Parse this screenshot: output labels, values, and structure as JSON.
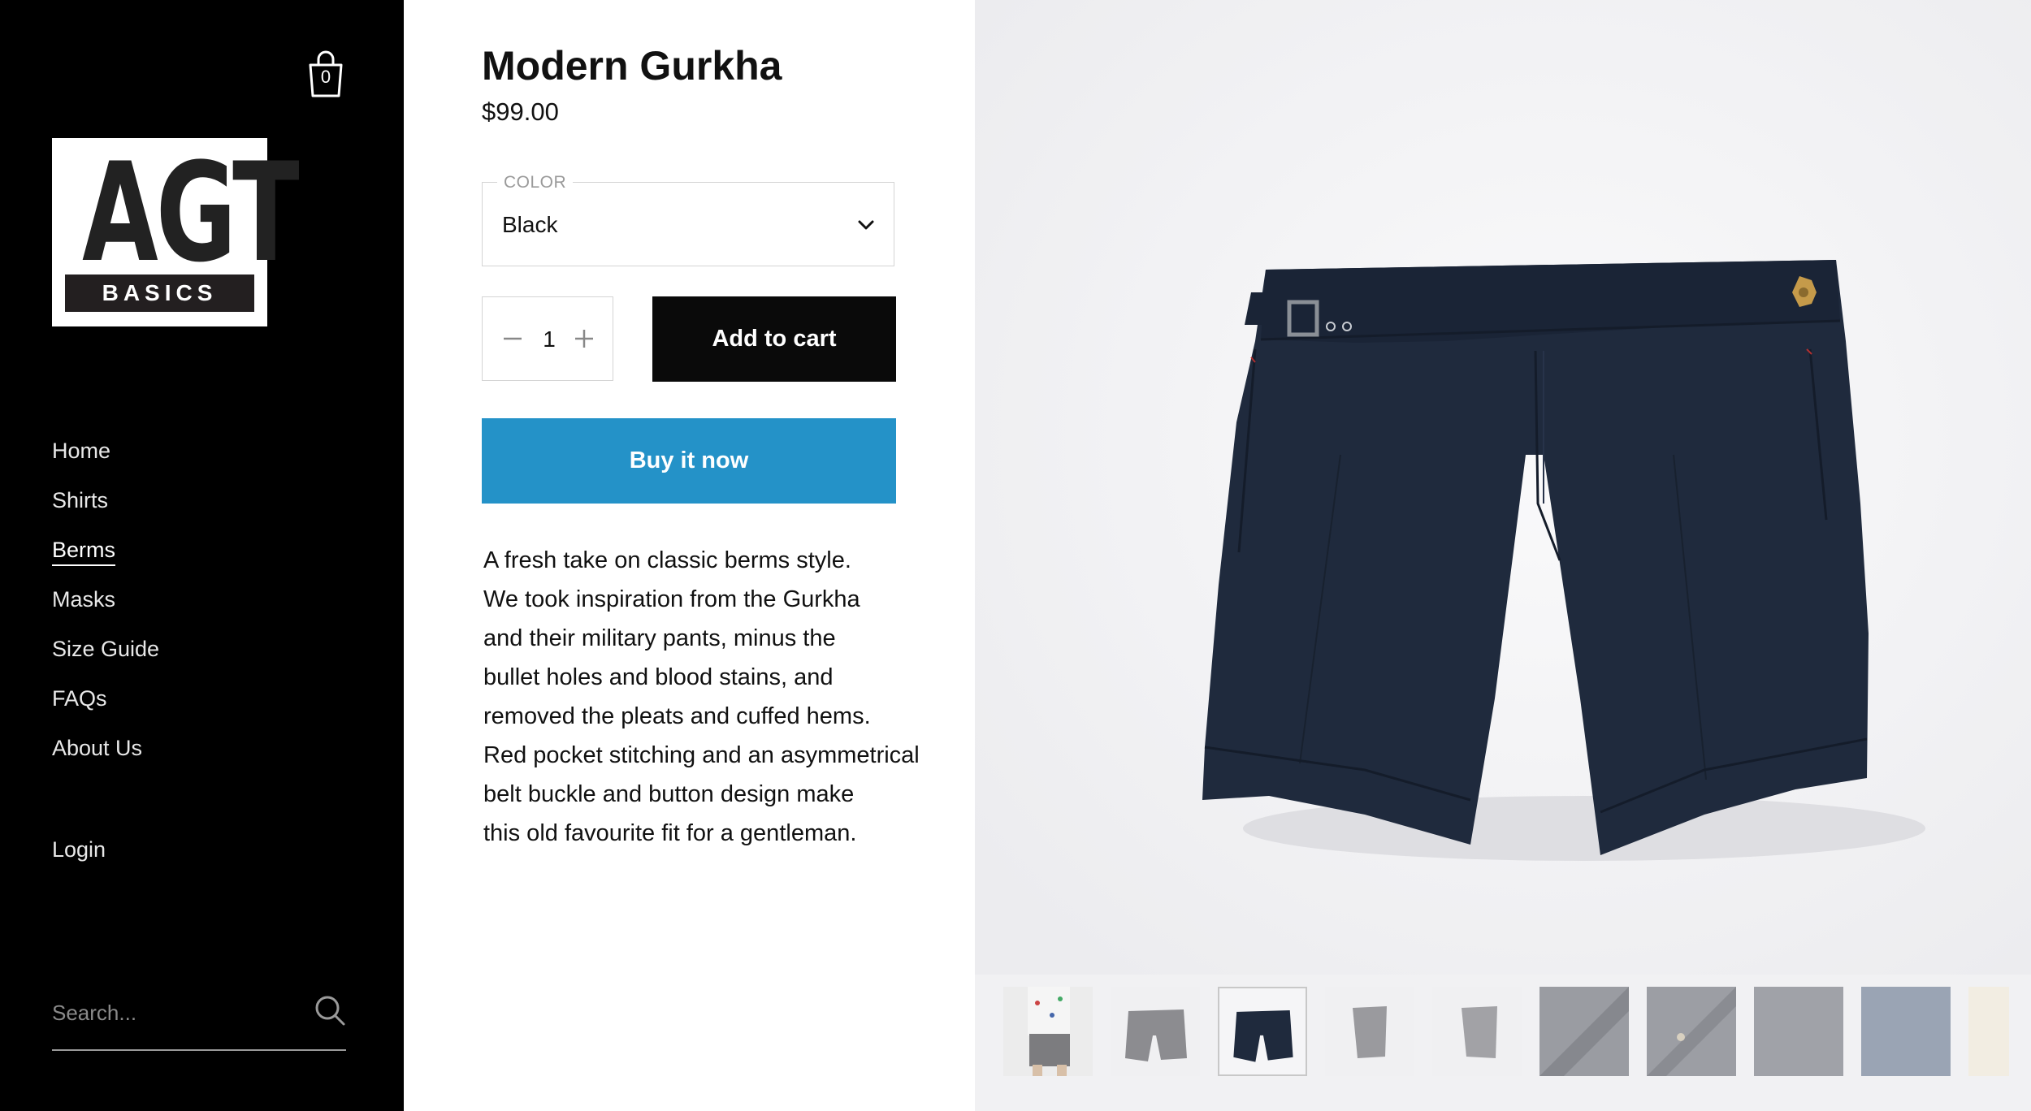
{
  "cart": {
    "count": "0"
  },
  "logo": {
    "big": "AGT",
    "band": "BASICS"
  },
  "nav": {
    "items": [
      {
        "label": "Home"
      },
      {
        "label": "Shirts"
      },
      {
        "label": "Berms",
        "active": true
      },
      {
        "label": "Masks"
      },
      {
        "label": "Size Guide"
      },
      {
        "label": "FAQs"
      },
      {
        "label": "About Us"
      }
    ],
    "login": "Login"
  },
  "search": {
    "placeholder": "Search..."
  },
  "product": {
    "title": "Modern Gurkha",
    "price": "$99.00",
    "color": {
      "label": "COLOR",
      "value": "Black"
    },
    "quantity": "1",
    "add_to_cart": "Add to cart",
    "buy_now": "Buy it now",
    "description": [
      "A fresh take on classic berms style.",
      "We took inspiration from the Gurkha",
      "and their military pants, minus the",
      "bullet holes and blood stains, and",
      "removed the pleats and cuffed hems.",
      "Red pocket stitching and an asymmetrical",
      "belt buckle and button design make",
      "this old favourite fit for a gentleman."
    ]
  },
  "colors": {
    "sidebar_bg": "#000000",
    "buy_now_bg": "#2492c8",
    "add_to_cart_bg": "#0a0a0a",
    "shorts_navy": "#1f2a3d"
  },
  "gallery": {
    "thumbnails": [
      {
        "subject": "model-wearing-shorts",
        "selected": false
      },
      {
        "subject": "grey-shorts-front",
        "selected": false
      },
      {
        "subject": "navy-shorts-front",
        "selected": true
      },
      {
        "subject": "grey-shorts-side",
        "selected": false
      },
      {
        "subject": "grey-shorts-side-alt",
        "selected": false
      },
      {
        "subject": "waistband-detail",
        "selected": false
      },
      {
        "subject": "button-detail",
        "selected": false
      },
      {
        "subject": "fabric-detail",
        "selected": false
      },
      {
        "subject": "blue-fabric-detail",
        "selected": false
      },
      {
        "subject": "cream-shorts-partial",
        "selected": false
      }
    ]
  }
}
